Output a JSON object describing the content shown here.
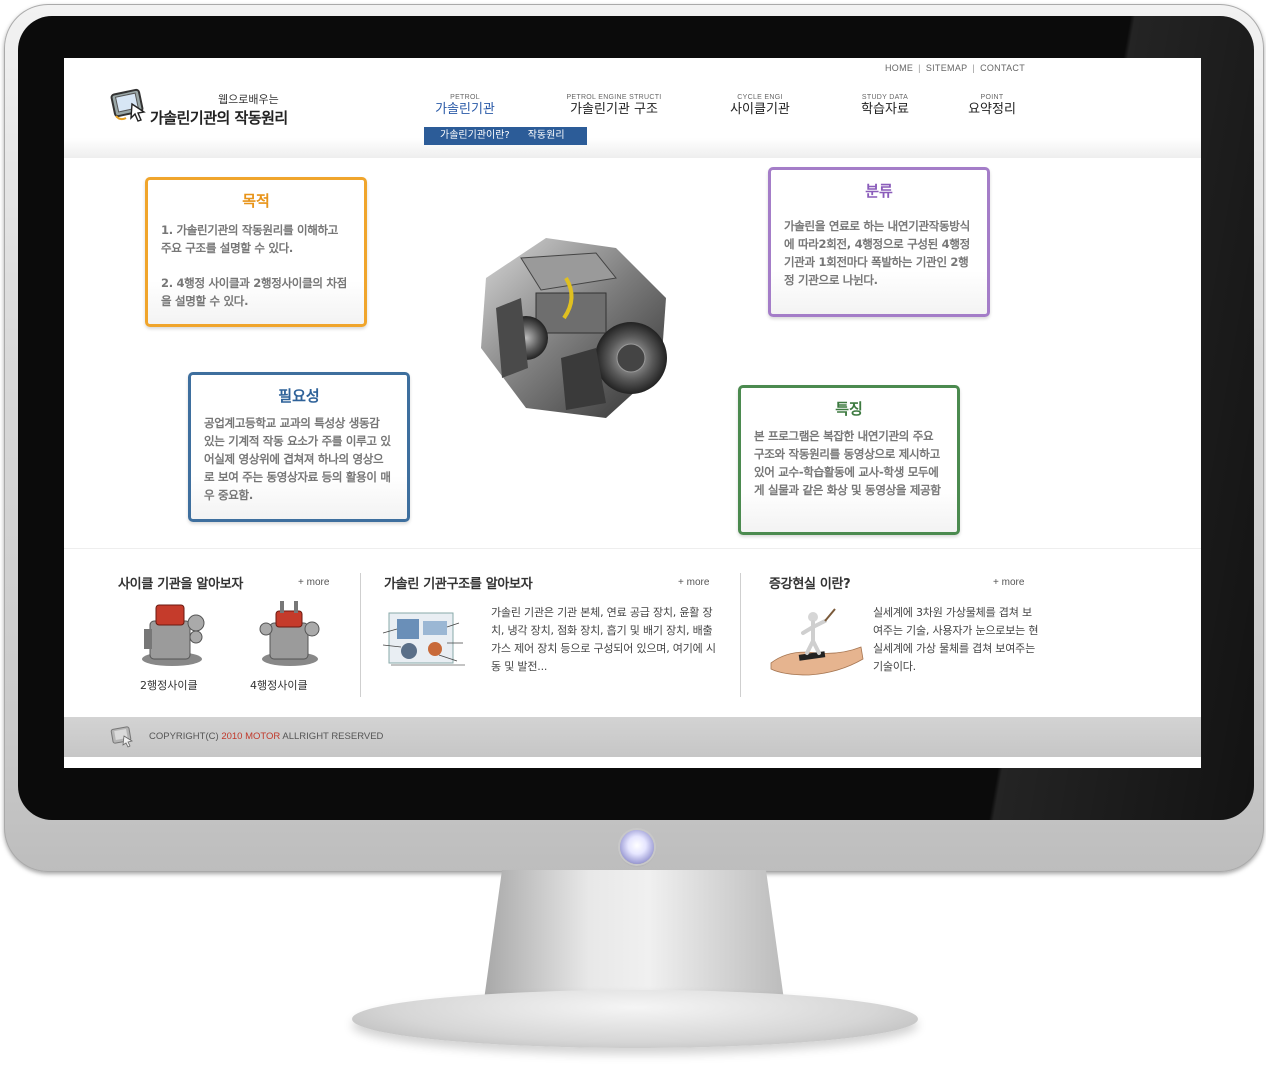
{
  "util_nav": {
    "home": "HOME",
    "sitemap": "SITEMAP",
    "contact": "CONTACT",
    "separator": "|"
  },
  "logo": {
    "small": "웹으로배우는",
    "main": "가솔린기관의 작동원리"
  },
  "nav": [
    {
      "eng": "PETROL",
      "kor": "가솔린기관"
    },
    {
      "eng": "PETROL ENGINE STRUCTI",
      "kor": "가솔린기관 구조"
    },
    {
      "eng": "CYCLE ENGI",
      "kor": "사이클기관"
    },
    {
      "eng": "STUDY DATA",
      "kor": "학습자료"
    },
    {
      "eng": "POINT",
      "kor": "요약정리"
    }
  ],
  "subnav": {
    "item1": "가솔린기관이란?",
    "item2": "작동원리"
  },
  "boxes": {
    "purpose": {
      "title": "목적",
      "p1": "1. 가솔린기관의 작동원리를 이해하고 주요 구조를 설명할 수 있다.",
      "p2": "2. 4행정 사이클과 2행정사이클의 차점을 설명할 수 있다."
    },
    "class": {
      "title": "분류",
      "body": "가솔린을 연료로 하는 내연기관작동방식에 따라2회전, 4행정으로 구성된 4행정기관과 1회전마다 폭발하는 기관인 2행정 기관으로 나뉜다."
    },
    "need": {
      "title": "필요성",
      "body": "공업계고등학교 교과의 특성상 생동감 있는 기계적 작동 요소가 주를 이루고 있어실제 영상위에 겹쳐져 하나의 영상으로 보여 주는 동영상자료 등의 활용이 매우 중요함."
    },
    "feat": {
      "title": "특징",
      "body": "본 프로그램은 복잡한 내연기관의 주요 구조와 작동원리를 동영상으로 제시하고 있어 교수-학습활동에 교사-학생 모두에게 실물과 같은 화상 및 동영상을 제공함"
    }
  },
  "panels": {
    "cycle": {
      "title": "사이클 기관을 알아보자",
      "more": "+ more",
      "label1": "2행정사이클",
      "label2": "4행정사이클"
    },
    "struct": {
      "title": "가솔린 기관구조를 알아보자",
      "more": "+ more",
      "text": "가솔린 기관은 기관 본체, 연료 공급 장치, 윤활 장치, 냉각 장치, 점화 장치, 흡기 및 배기 장치, 배출 가스 제어 장치 등으로 구성되어 있으며, 여기에 시동 및 발전..."
    },
    "ar": {
      "title": "증강현실 이란?",
      "more": "+ more",
      "text": "실세계에 3차원 가상물체를 겹쳐 보여주는 기술, 사용자가 눈으로보는 현실세계에 가상 물체를 겹쳐 보여주는 기술이다."
    }
  },
  "footer": {
    "prefix": "COPYRIGHT(C) ",
    "accent": "2010 MOTOR",
    "suffix": " ALLRIGHT RESERVED"
  },
  "colors": {
    "purpose": "#f0a52c",
    "class": "#a47dc8",
    "need": "#3e6f9e",
    "feature": "#4b8a4f",
    "subnav": "#2c5c98",
    "footer_accent": "#c0392b"
  }
}
